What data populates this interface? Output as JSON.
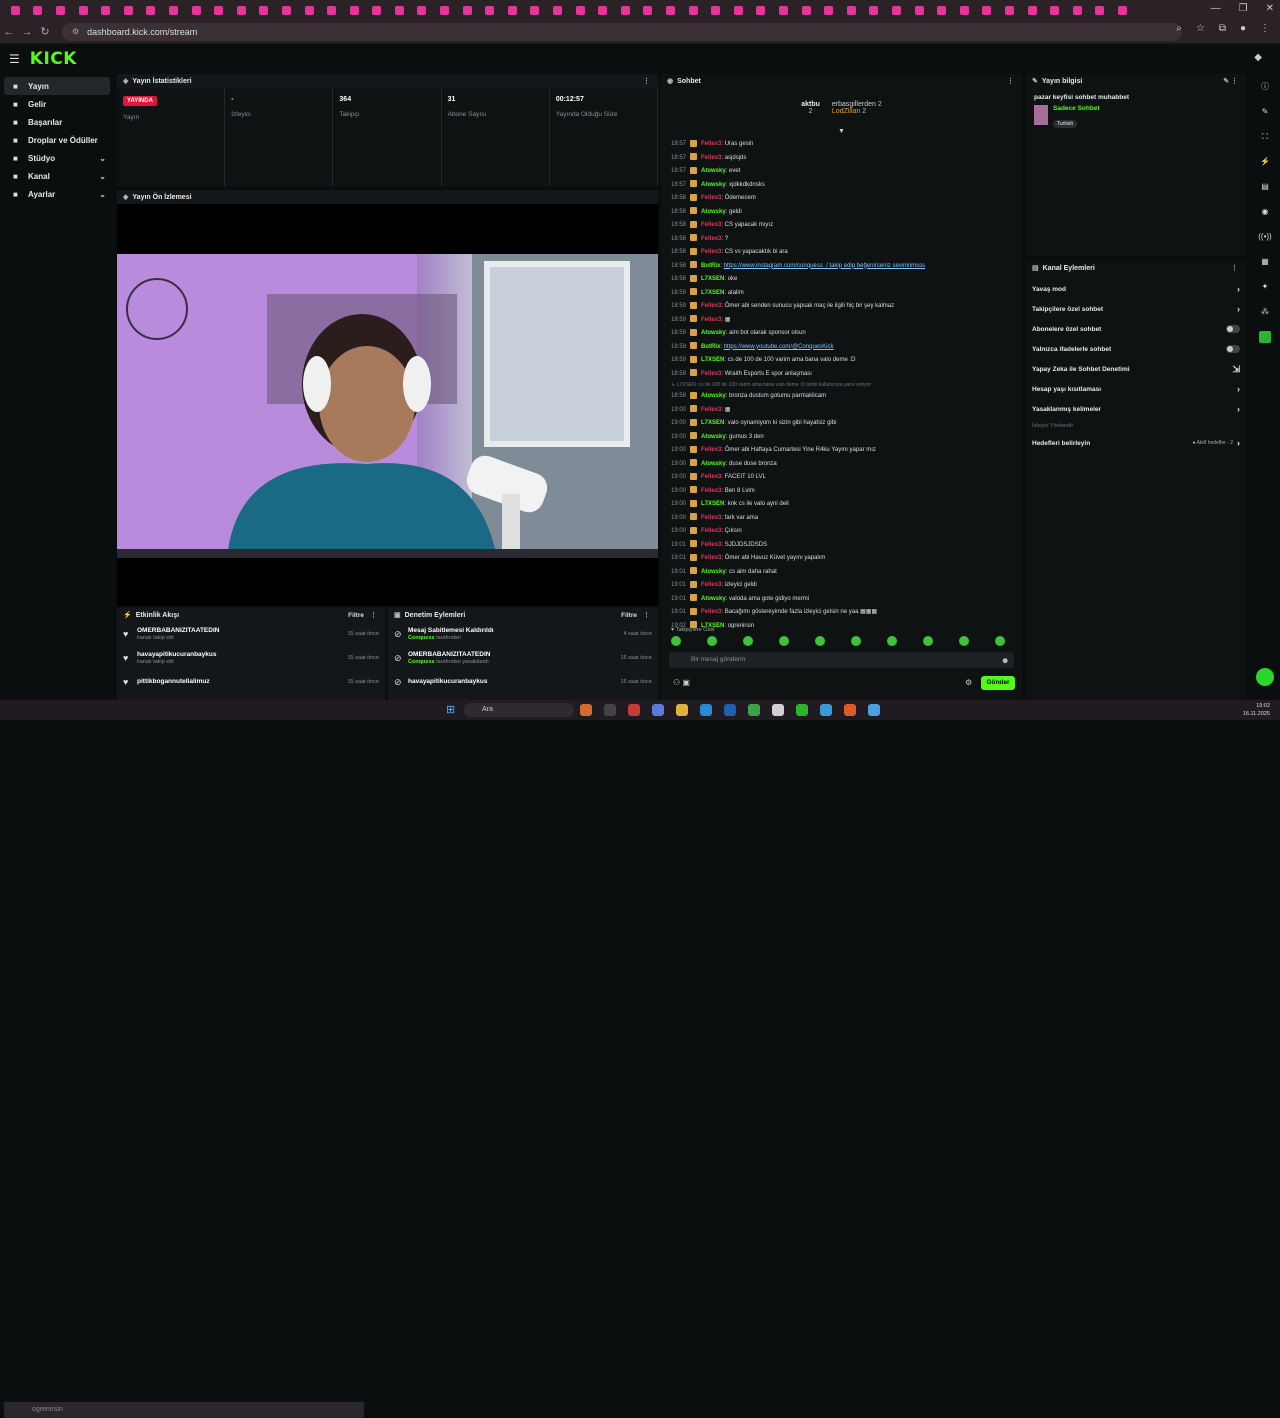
{
  "browser": {
    "url": "dashboard.kick.com/stream",
    "tab_count": 50
  },
  "header": {
    "logo": "KICK"
  },
  "sidebar": {
    "items": [
      {
        "label": "Yayın",
        "icon": "broadcast-icon",
        "active": true
      },
      {
        "label": "Gelir",
        "icon": "wallet-icon"
      },
      {
        "label": "Başarılar",
        "icon": "trophy-icon"
      },
      {
        "label": "Droplar ve Ödüller",
        "icon": "gift-icon"
      },
      {
        "label": "Stüdyo",
        "icon": "studio-icon",
        "expandable": true
      },
      {
        "label": "Kanal",
        "icon": "channel-icon",
        "expandable": true
      },
      {
        "label": "Ayarlar",
        "icon": "settings-icon",
        "expandable": true
      }
    ]
  },
  "stats": {
    "title": "Yayın İstatistikleri",
    "live_badge": "YAYINDA",
    "cells": [
      {
        "value": "",
        "label": "Yayın"
      },
      {
        "value": "-",
        "label": "İzleyici"
      },
      {
        "value": "364",
        "label": "Takipçi"
      },
      {
        "value": "31",
        "label": "Abone Sayısı"
      },
      {
        "value": "00:12:57",
        "label": "Yayında Olduğu Süre"
      }
    ]
  },
  "preview": {
    "title": "Yayın Ön İzlemesi"
  },
  "activity": {
    "title": "Etkinlik Akışı",
    "filter": "Filtre",
    "rows": [
      {
        "name": "OMERBABANIZITAATEDIN",
        "sub": "kanalı takip etti",
        "time": "15 saat önce"
      },
      {
        "name": "havayapitikucuranbaykus",
        "sub": "kanalı takip etti",
        "time": "15 saat önce"
      },
      {
        "name": "pittikbogannutellalimuz",
        "sub": "",
        "time": "15 saat önce"
      }
    ]
  },
  "moderation": {
    "title": "Denetim Eylemleri",
    "filter": "Filtre",
    "rows": [
      {
        "name": "Mesaj Sabitlemesi Kaldırıldı",
        "by": "Conquess",
        "suffix": "tarafından",
        "time": "4 saat önce"
      },
      {
        "name": "OMERBABANIZITAATEDIN",
        "by": "Conquess",
        "suffix": "tarafından yasaklandı",
        "time": "15 saat önce"
      },
      {
        "name": "havayapitikucuranbaykus",
        "by": "",
        "suffix": "",
        "time": "15 saat önce"
      }
    ]
  },
  "chat": {
    "title": "Sohbet",
    "top_users": [
      {
        "name": "aktbu",
        "count": "2"
      },
      {
        "name": "erbasgillerden",
        "count": "2"
      },
      {
        "name": "LodZillan",
        "count": "2"
      }
    ],
    "messages": [
      {
        "t": "18:57",
        "u": "Fellex3",
        "c": "#e0355a",
        "m": "Uras gesin"
      },
      {
        "t": "18:57",
        "u": "Fellex3",
        "c": "#e0355a",
        "m": "asjdsjds"
      },
      {
        "t": "18:57",
        "u": "Atowsky",
        "c": "#53fc18",
        "m": "evet"
      },
      {
        "t": "18:57",
        "u": "Atowsky",
        "c": "#53fc18",
        "m": "xjdkkdkdnsks"
      },
      {
        "t": "18:58",
        "u": "Fellex3",
        "c": "#e0355a",
        "m": "Ödemecem"
      },
      {
        "t": "18:58",
        "u": "Atowsky",
        "c": "#53fc18",
        "m": "geldi"
      },
      {
        "t": "18:58",
        "u": "Fellex3",
        "c": "#e0355a",
        "m": "CS yapacak mıyız"
      },
      {
        "t": "18:58",
        "u": "Fellex3",
        "c": "#e0355a",
        "m": "?"
      },
      {
        "t": "18:58",
        "u": "Fellex3",
        "c": "#e0355a",
        "m": "CS vs yapacaktık bi ara"
      },
      {
        "t": "18:58",
        "u": "BotRix",
        "c": "#53fc18",
        "m": "https://www.instagram.com/conquess_/ takip edip beğenirseniz sevinirimsss",
        "link": true
      },
      {
        "t": "18:58",
        "u": "L7XSEN",
        "c": "#53fc18",
        "m": "oke"
      },
      {
        "t": "18:59",
        "u": "L7XSEN",
        "c": "#53fc18",
        "m": "atalim"
      },
      {
        "t": "18:59",
        "u": "Fellex3",
        "c": "#e0355a",
        "m": "Ömer abi senden sunucu yapsak maç ile ilgili hiç bir şey kalmaz"
      },
      {
        "t": "18:59",
        "u": "Fellex3",
        "c": "#e0355a",
        "m": "▦"
      },
      {
        "t": "18:59",
        "u": "Atowsky",
        "c": "#53fc18",
        "m": "aim bot olarak sponsor olsun"
      },
      {
        "t": "18:59",
        "u": "BotRix",
        "c": "#53fc18",
        "m": "https://www.youtube.com/@ConquesKick",
        "link": true
      },
      {
        "t": "18:59",
        "u": "L7XSEN",
        "c": "#53fc18",
        "m": "cs de 100 de 100 varim ama bana valo deme :D"
      },
      {
        "t": "18:59",
        "u": "Fellex3",
        "c": "#e0355a",
        "m": "Wraith Esports E spor anlaşması"
      },
      {
        "t": "",
        "u": "",
        "c": "",
        "m": "↳ L7XSEN: cs de 100 de 100 varim ama bana valo deme :D isimli kullanıcıya yanıt veriyor",
        "reply": true
      },
      {
        "t": "18:59",
        "u": "Atowsky",
        "c": "#53fc18",
        "m": "bronza dustum gotumu parmaklicam"
      },
      {
        "t": "19:00",
        "u": "Fellex3",
        "c": "#e0355a",
        "m": "▦"
      },
      {
        "t": "19:00",
        "u": "L7XSEN",
        "c": "#53fc18",
        "m": "valo oynamiyom ki sizin gibi hayatsiz gibi"
      },
      {
        "t": "19:00",
        "u": "Atowsky",
        "c": "#53fc18",
        "m": "gumus 3 den"
      },
      {
        "t": "19:00",
        "u": "Fellex3",
        "c": "#e0355a",
        "m": "Ömer abi Haftaya Cumartesi Yine R4ku Yayını yapar mız"
      },
      {
        "t": "19:00",
        "u": "Atowsky",
        "c": "#53fc18",
        "m": "duse duse bronza"
      },
      {
        "t": "19:00",
        "u": "Fellex3",
        "c": "#e0355a",
        "m": "FACEIT 10 LVL"
      },
      {
        "t": "19:00",
        "u": "Fellex3",
        "c": "#e0355a",
        "m": "Ben 8 Lvlm"
      },
      {
        "t": "19:00",
        "u": "L7XSEN",
        "c": "#53fc18",
        "m": "knk cs ile valo ayni deil"
      },
      {
        "t": "19:00",
        "u": "Fellex3",
        "c": "#e0355a",
        "m": "fark var ama"
      },
      {
        "t": "19:00",
        "u": "Fellex3",
        "c": "#e0355a",
        "m": "Çıksın"
      },
      {
        "t": "19:01",
        "u": "Fellex3",
        "c": "#e0355a",
        "m": "SJDJDSJDSDS"
      },
      {
        "t": "19:01",
        "u": "Fellex3",
        "c": "#e0355a",
        "m": "Ömer abi Havuz Küvet yayını yapalım"
      },
      {
        "t": "19:01",
        "u": "Atowsky",
        "c": "#53fc18",
        "m": "cs aim daha rahat"
      },
      {
        "t": "19:01",
        "u": "Fellex3",
        "c": "#e0355a",
        "m": "izleyici geldi"
      },
      {
        "t": "19:01",
        "u": "Atowsky",
        "c": "#53fc18",
        "m": "valoda ama gote gidiyo mermi"
      },
      {
        "t": "19:01",
        "u": "Fellex3",
        "c": "#e0355a",
        "m": "Bacağımı göstereyimde fazla izleyici gelsin ne yaa ▦▦▦"
      },
      {
        "t": "19:02",
        "u": "L7XSEN",
        "c": "#53fc18",
        "m": "ogrenirsin"
      }
    ],
    "followers_only": "Takipçilere Özel",
    "input_placeholder": "Bir mesaj gönderin",
    "send": "Gönder"
  },
  "stream_info": {
    "title": "Yayın bilgisi",
    "stream_title": "pazar keyfisi sohbet muhabbet",
    "category": "Sadece Sohbet",
    "language": "Turkish"
  },
  "channel_actions": {
    "title": "Kanal Eylemleri",
    "rows": [
      {
        "label": "Yavaş mod",
        "kind": "arrow"
      },
      {
        "label": "Takipçilere özel sohbet",
        "kind": "arrow"
      },
      {
        "label": "Abonelere özel sohbet",
        "kind": "toggle"
      },
      {
        "label": "Yalnızca ifadelerle sohbet",
        "kind": "toggle"
      },
      {
        "label": "Yapay Zeka ile Sohbet Denetimi",
        "kind": "ext"
      },
      {
        "label": "Hesap yaşı kısıtlaması",
        "kind": "arrow"
      },
      {
        "label": "Yasaklanmış kelimeler",
        "kind": "arrow"
      }
    ],
    "section": "İzleyici Yönlendir",
    "goal_label": "Hedefleri belirleyin",
    "goal_status": "Aktif hedefler - 2"
  },
  "taskbar": {
    "left_text": "ogrenirsin",
    "search": "Ara",
    "time": "19:02",
    "date": "16.11.2025"
  }
}
